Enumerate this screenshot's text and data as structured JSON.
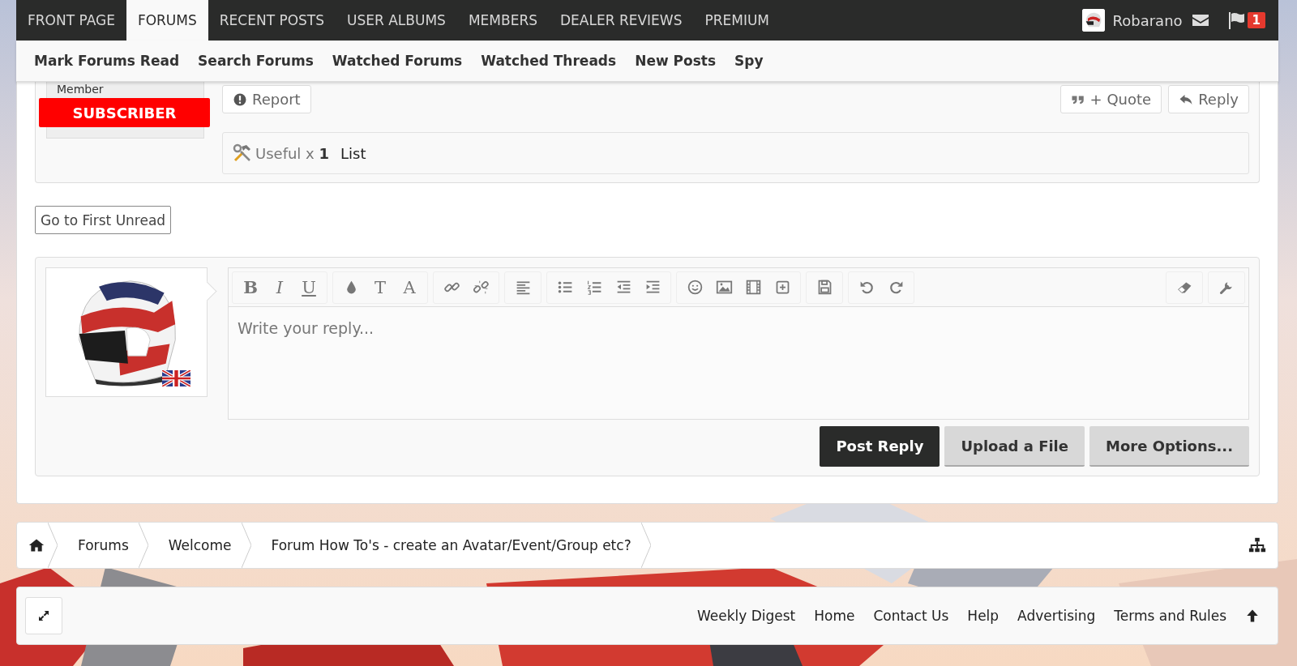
{
  "top_nav": {
    "tabs": [
      {
        "label": "FRONT PAGE",
        "selected": false
      },
      {
        "label": "FORUMS",
        "selected": true
      },
      {
        "label": "RECENT POSTS",
        "selected": false
      },
      {
        "label": "USER ALBUMS",
        "selected": false
      },
      {
        "label": "MEMBERS",
        "selected": false
      },
      {
        "label": "DEALER REVIEWS",
        "selected": false
      },
      {
        "label": "PREMIUM",
        "selected": false
      }
    ],
    "user_name": "Robarano",
    "alerts_count": "1"
  },
  "sub_nav": [
    "Mark Forums Read",
    "Search Forums",
    "Watched Forums",
    "Watched Threads",
    "New Posts",
    "Spy"
  ],
  "post": {
    "member_title": "Member",
    "banner": "SUBSCRIBER",
    "report_button": "Report",
    "quote_button": "+ Quote",
    "reply_button": "Reply",
    "ratings": {
      "label": "Useful x ",
      "count": "1",
      "list_link": "List"
    }
  },
  "first_unread_button": "Go to First Unread",
  "editor": {
    "glyphs": [
      "B",
      "I",
      "U",
      "T",
      "A"
    ],
    "placeholder": "Write your reply...",
    "buttons": [
      {
        "label": "Post Reply",
        "kind": "primary"
      },
      {
        "label": "Upload a File",
        "kind": "secondary"
      },
      {
        "label": "More Options...",
        "kind": "secondary"
      }
    ]
  },
  "breadcrumb": [
    "Forums",
    "Welcome",
    "Forum How To's - create an Avatar/Event/Group etc?"
  ],
  "footer_links": [
    "Weekly Digest",
    "Home",
    "Contact Us",
    "Help",
    "Advertising",
    "Terms and Rules"
  ]
}
